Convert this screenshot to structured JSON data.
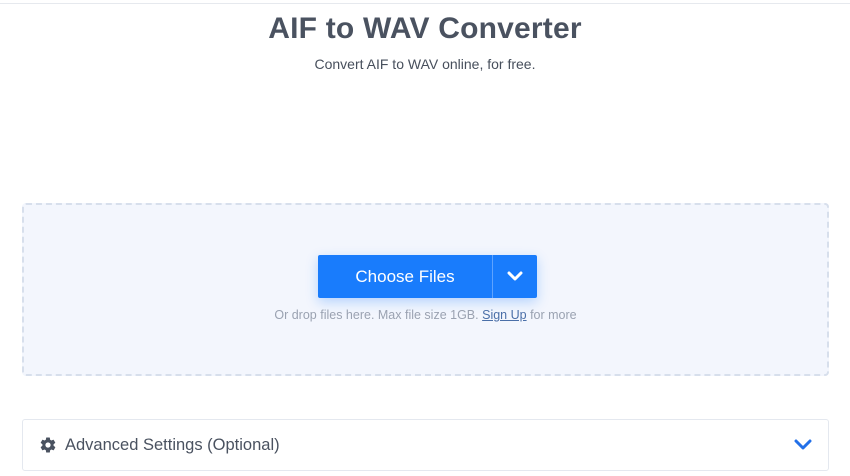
{
  "header": {
    "title": "AIF to WAV Converter",
    "subtitle": "Convert AIF to WAV online, for free."
  },
  "upload": {
    "choose_label": "Choose Files",
    "hint_prefix": "Or drop files here. Max file size 1GB.",
    "signup_link": "Sign Up",
    "hint_suffix": "for more",
    "icons": {
      "dropdown": "chevron-down-icon"
    }
  },
  "advanced": {
    "label": "Advanced Settings (Optional)",
    "icons": {
      "left": "gear-icon",
      "right": "chevron-down-icon"
    }
  },
  "colors": {
    "accent": "#197cfc",
    "dropzone_bg": "#f3f6fd",
    "text": "#4a5260",
    "hint": "#9aa2b1",
    "link": "#4a6fa8",
    "chevron": "#2370e8"
  }
}
